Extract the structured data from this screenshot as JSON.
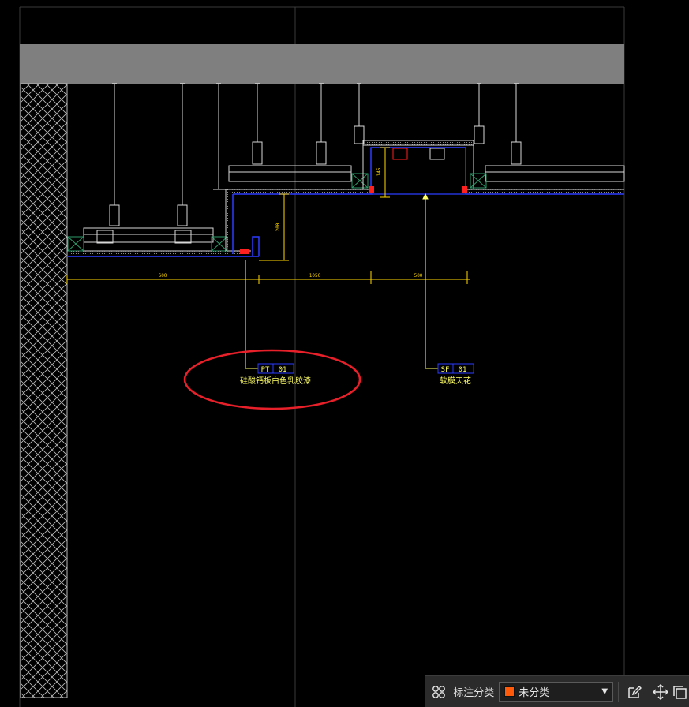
{
  "drawing": {
    "dimensions": {
      "left_span": "600",
      "middle_span": "1050",
      "right_span": "500",
      "vertical_drop": "200",
      "recess_depth": "145"
    },
    "tags": [
      {
        "code": "PT",
        "number": "01",
        "description": "硅酸钙板白色乳胶漆"
      },
      {
        "code": "SF",
        "number": "01",
        "description": "软膜天花"
      }
    ],
    "colors": {
      "background": "#000000",
      "slab": "#7f7f7f",
      "linework": "#d8d8d8",
      "finish_line": "#2a3cff",
      "dimension": "#ffd800",
      "leader": "#ffff66",
      "highlight_ring": "#e8202a",
      "fixing_red": "#ff2020",
      "hatch": "#bcbcbc",
      "section_box": "#1e8c5a"
    }
  },
  "toolbar": {
    "category_label": "标注分类",
    "selected_category": "未分类",
    "selected_color": "#ff5a0a",
    "icons": [
      "grid-view-icon",
      "edit-note-icon",
      "move-icon",
      "copy-icon"
    ]
  }
}
